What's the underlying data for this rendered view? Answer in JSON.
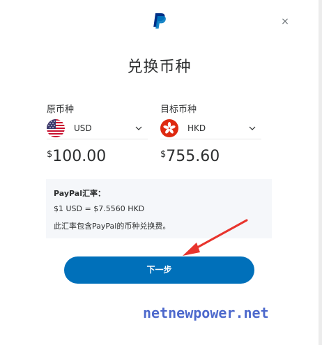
{
  "header": {
    "logo_icon": "paypal-logo-icon",
    "close_icon": "close-icon",
    "close_glyph": "×"
  },
  "title": "兑换币种",
  "source": {
    "label": "原币种",
    "currency_code": "USD",
    "flag_icon": "us-flag-icon",
    "currency_symbol": "$",
    "amount": "100.00"
  },
  "target": {
    "label": "目标币种",
    "currency_code": "HKD",
    "flag_icon": "hk-flag-icon",
    "currency_symbol": "$",
    "amount": "755.60"
  },
  "rate_box": {
    "heading": "PayPal汇率：",
    "rate": "$1 USD = $7.5560 HKD",
    "note": "此汇率包含PayPal的币种兑换费。"
  },
  "next_button": {
    "label": "下一步"
  },
  "annotation": {
    "arrow_color": "#e8342d"
  },
  "watermark": "netnewpower.net",
  "colors": {
    "primary_button": "#0070ba",
    "info_bg": "#f5f7fa",
    "text": "#2c2e2f"
  }
}
